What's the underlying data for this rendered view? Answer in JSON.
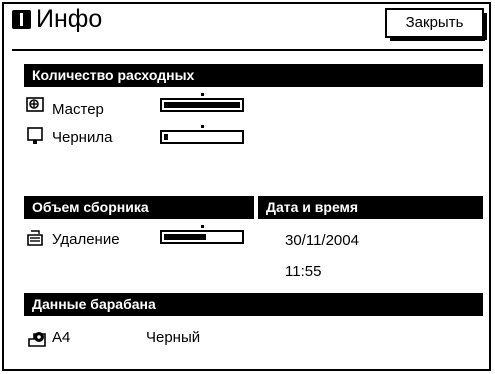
{
  "window": {
    "title": "Инфо",
    "close_label": "Закрыть"
  },
  "consumables": {
    "header": "Количество расходных",
    "items": [
      {
        "label": "Мастер",
        "level": 1.0
      },
      {
        "label": "Чернила",
        "level": 0.05
      }
    ]
  },
  "tray": {
    "header": "Объем сборника",
    "items": [
      {
        "label": "Удаление",
        "level": 0.55
      }
    ]
  },
  "datetime": {
    "header": "Дата и время",
    "date": "30/11/2004",
    "time": "11:55"
  },
  "drum": {
    "header": "Данные барабана",
    "size": "A4",
    "color": "Черный"
  }
}
